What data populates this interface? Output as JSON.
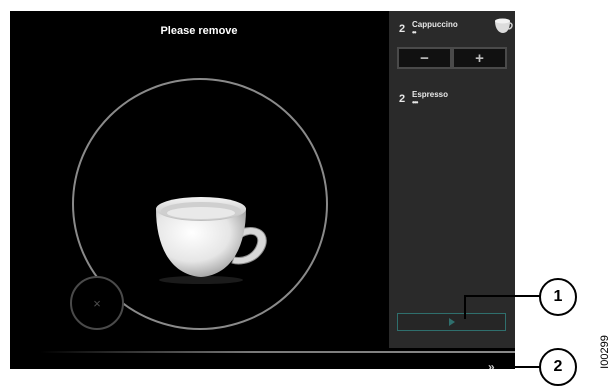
{
  "screen": {
    "title": "Please remove",
    "cancel_glyph": "×"
  },
  "order_panel": {
    "items": [
      {
        "qty": "2",
        "name": "Cappuccino",
        "strength": "••",
        "icon": "cup-icon"
      },
      {
        "qty": "2",
        "name": "Espresso",
        "strength": "•••"
      }
    ],
    "minus_label": "−",
    "plus_label": "+",
    "start_icon": "play-icon",
    "start_color": "#2f6f6d"
  },
  "bottom": {
    "next_glyph": "»"
  },
  "callouts": [
    {
      "label": "1"
    },
    {
      "label": "2"
    }
  ],
  "figure_id": "I00299"
}
